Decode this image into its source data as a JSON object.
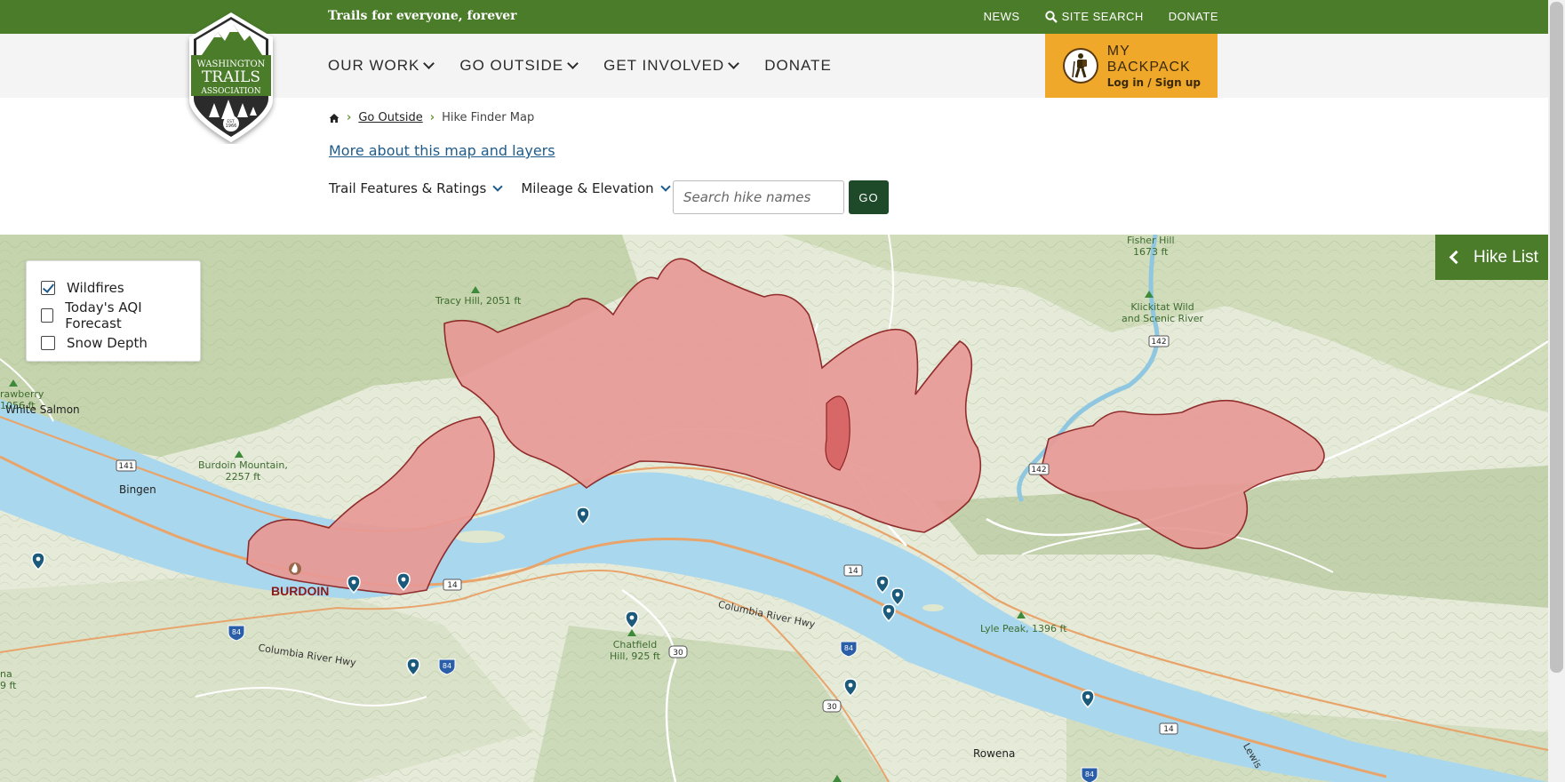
{
  "topbar": {
    "tagline": "Trails for everyone, forever",
    "links": {
      "news": "NEWS",
      "site_search": "SITE SEARCH",
      "donate": "DONATE"
    }
  },
  "logo": {
    "line1": "WASHINGTON",
    "line2": "TRAILS",
    "line3": "ASSOCIATION",
    "est": "EST.",
    "year": "1966"
  },
  "nav": {
    "our_work": "OUR WORK",
    "go_outside": "GO OUTSIDE",
    "get_involved": "GET INVOLVED",
    "donate": "DONATE"
  },
  "backpack": {
    "title": "MY BACKPACK",
    "subtitle": "Log in / Sign up"
  },
  "breadcrumb": {
    "parent": "Go Outside",
    "current": "Hike Finder Map"
  },
  "more_link": "More about this map and layers",
  "filters": {
    "features": "Trail Features & Ratings",
    "mileage": "Mileage & Elevation",
    "search_placeholder": "Search hike names",
    "go_label": "GO"
  },
  "layers": {
    "wildfires": "Wildfires",
    "aqi": "Today's AQI Forecast",
    "snow": "Snow Depth"
  },
  "hike_list": "Hike List",
  "map": {
    "labels": {
      "tracy_hill": "Tracy Hill, 2051 ft",
      "fisher_hill_1": "Fisher Hill",
      "fisher_hill_2": "1673 ft",
      "klickitat_1": "Klickitat Wild",
      "klickitat_2": "and Scenic River",
      "burdoin_mtn_1": "Burdoin Mountain,",
      "burdoin_mtn_2": "2257 ft",
      "lyle_peak": "Lyle Peak, 1396 ft",
      "chatfield_1": "Chatfield",
      "chatfield_2": "Hill, 925 ft",
      "strawberry_1": "rawberry",
      "strawberry_2": "1056 ft",
      "na_1": "na",
      "na_2": "9 ft"
    },
    "towns": {
      "white_salmon": "White Salmon",
      "bingen": "Bingen",
      "rowena": "Rowena",
      "fire_name": "BURDOIN"
    },
    "roads": {
      "columbia_hwy_1": "Columbia River Hwy",
      "columbia_hwy_2": "Columbia River Hwy",
      "lewis": "Lewis",
      "r141": "141",
      "r142a": "142",
      "r142b": "142",
      "r14a": "14",
      "r14b": "14",
      "r14c": "14",
      "i84a": "84",
      "i84b": "84",
      "i84c": "84",
      "i84d": "84",
      "r30a": "30",
      "r30b": "30"
    }
  }
}
